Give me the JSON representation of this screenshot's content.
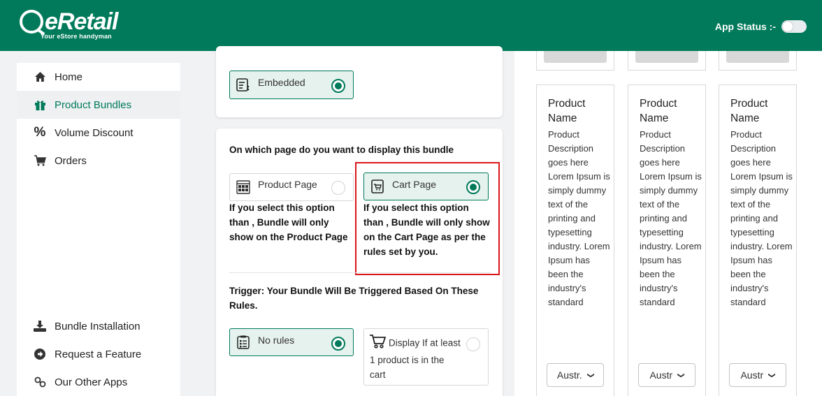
{
  "brand": {
    "name": "eRetail",
    "tagline": "Your eStore handyman"
  },
  "header": {
    "app_status_label": "App Status :-"
  },
  "sidebar": {
    "items": [
      {
        "label": "Home",
        "icon": "home-icon"
      },
      {
        "label": "Product Bundles",
        "icon": "gift-icon",
        "active": true
      },
      {
        "label": "Volume Discount",
        "icon": "percent-icon"
      },
      {
        "label": "Orders",
        "icon": "cart-icon"
      },
      {
        "label": "Bundle Installation",
        "icon": "download-icon"
      },
      {
        "label": "Request a Feature",
        "icon": "arrow-circle-icon"
      },
      {
        "label": "Our Other Apps",
        "icon": "link-icon"
      }
    ]
  },
  "layout_card": {
    "embedded_label": "Embedded"
  },
  "display_card": {
    "question": "On which page do you want to display this bundle",
    "product_page_label": "Product Page",
    "product_page_note": "If you select this option than , Bundle will only show on the Product Page",
    "cart_page_label": "Cart Page",
    "cart_page_note": "If you select this option than , Bundle will only show on the Cart Page as per the rules set by you.",
    "trigger_heading": "Trigger: Your Bundle Will Be Triggered Based On These Rules.",
    "no_rules_label": "No rules",
    "display_if_label": "Display If at least 1 product is in the cart"
  },
  "preview": {
    "products": [
      {
        "name": "Product Name",
        "description": "Product Description goes here Lorem Ipsum is simply dummy text of the printing and typesetting industry. Lorem Ipsum has been the industry's standard",
        "select_value": "Austr."
      },
      {
        "name": "Product Name",
        "description": "Product Description goes here Lorem Ipsum is simply dummy text of the printing and typesetting industry. Lorem Ipsum has been the industry's standard",
        "select_value": "Austr"
      },
      {
        "name": "Product Name",
        "description": "Product Description goes here Lorem Ipsum is simply dummy text of the printing and typesetting industry. Lorem Ipsum has been the industry's standard",
        "select_value": "Austr"
      }
    ]
  },
  "colors": {
    "brand_green": "#007a5a",
    "highlight_red": "#d9161b"
  }
}
